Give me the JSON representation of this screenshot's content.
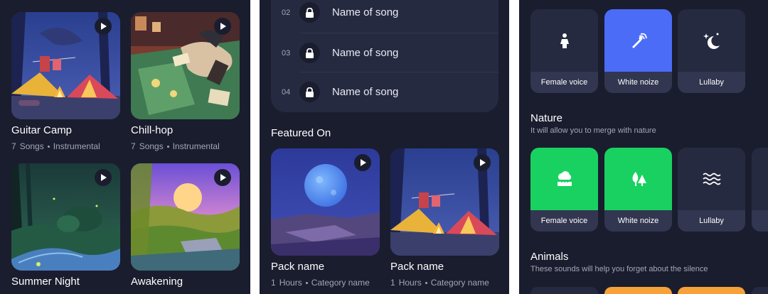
{
  "colors": {
    "background": "#1a1d2e",
    "surface": "#262a40",
    "tile_label_bg": "#323650",
    "accent_blue": "#4a6cf7",
    "accent_green": "#19d161",
    "accent_orange": "#f7a13a",
    "text_primary": "#ffffff",
    "text_secondary": "#a3a6b8"
  },
  "library": {
    "cards": [
      {
        "title": "Guitar Camp",
        "count": "7",
        "count_unit": "Songs",
        "category": "Instrumental",
        "artwork": "campfire-tents-night"
      },
      {
        "title": "Chill-hop",
        "count": "7",
        "count_unit": "Songs",
        "category": "Instrumental",
        "artwork": "cozy-room-raccoon"
      },
      {
        "title": "Summer Night",
        "artwork": "forest-night-path"
      },
      {
        "title": "Awakening",
        "artwork": "sunrise-meadow"
      }
    ]
  },
  "pack": {
    "songs": [
      {
        "num": "02",
        "name": "Name of song",
        "icon": "lock-icon"
      },
      {
        "num": "03",
        "name": "Name of song",
        "icon": "lock-icon"
      },
      {
        "num": "04",
        "name": "Name of song",
        "icon": "lock-icon"
      }
    ],
    "featured_title": "Featured On",
    "featured": [
      {
        "name": "Pack name",
        "count": "1",
        "count_unit": "Hours",
        "category": "Category name",
        "artwork": "moon-cliff-night"
      },
      {
        "name": "Pack name",
        "count": "1",
        "count_unit": "Hours",
        "category": "Category name",
        "artwork": "campfire-tents-night"
      }
    ]
  },
  "sounds": {
    "top_row": [
      {
        "label": "Female voice",
        "icon": "female-icon",
        "state": "default"
      },
      {
        "label": "White noize",
        "icon": "wand-icon",
        "state": "selected-blue"
      },
      {
        "label": "Lullaby",
        "icon": "moon-stars-icon",
        "state": "default"
      }
    ],
    "nature": {
      "title": "Nature",
      "subtitle": "It will allow you to merge with nature",
      "tiles": [
        {
          "label": "Female voice",
          "icon": "rain-cloud-icon",
          "state": "selected-green"
        },
        {
          "label": "White noize",
          "icon": "trees-icon",
          "state": "selected-green"
        },
        {
          "label": "Lullaby",
          "icon": "waves-icon",
          "state": "default"
        }
      ]
    },
    "animals": {
      "title": "Animals",
      "subtitle": "These sounds will help you forget about the silence"
    }
  }
}
